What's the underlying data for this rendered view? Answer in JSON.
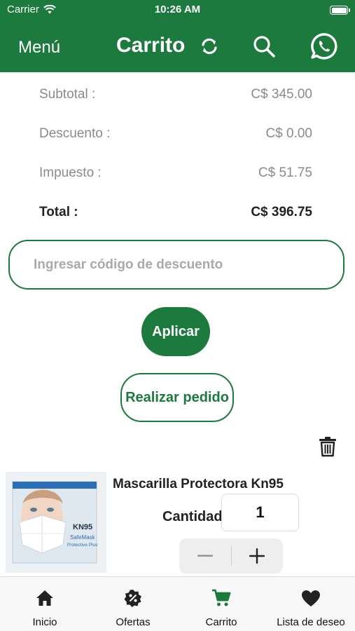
{
  "status_bar": {
    "carrier": "Carrier",
    "time": "10:26 AM"
  },
  "navbar": {
    "menu_label": "Menú",
    "title": "Carrito",
    "icons": [
      "refresh-icon",
      "search-icon",
      "whatsapp-icon"
    ]
  },
  "summary": {
    "subtotal": {
      "label": "Subtotal :",
      "value": "C$ 345.00"
    },
    "descuento": {
      "label": "Descuento :",
      "value": "C$ 0.00"
    },
    "impuesto": {
      "label": "Impuesto :",
      "value": "C$ 51.75"
    },
    "total": {
      "label": "Total :",
      "value": "C$ 396.75"
    }
  },
  "discount": {
    "placeholder": "Ingresar código de descuento",
    "value": ""
  },
  "buttons": {
    "apply": "Aplicar",
    "order": "Realizar pedido"
  },
  "product": {
    "name": "Mascarilla Protectora Kn95",
    "quantity_label": "Cantidad",
    "quantity": "1",
    "image_text": {
      "line1": "KN95",
      "line2": "SafeMask",
      "line3": "Protective Plus"
    }
  },
  "tabs": [
    {
      "label": "Inicio",
      "icon": "home-icon"
    },
    {
      "label": "Ofertas",
      "icon": "discount-badge-icon"
    },
    {
      "label": "Carrito",
      "icon": "cart-icon",
      "active": true
    },
    {
      "label": "Lista de deseo",
      "icon": "heart-icon"
    }
  ],
  "colors": {
    "brand": "#1d7a3e",
    "muted_text": "#8a8a8a"
  }
}
